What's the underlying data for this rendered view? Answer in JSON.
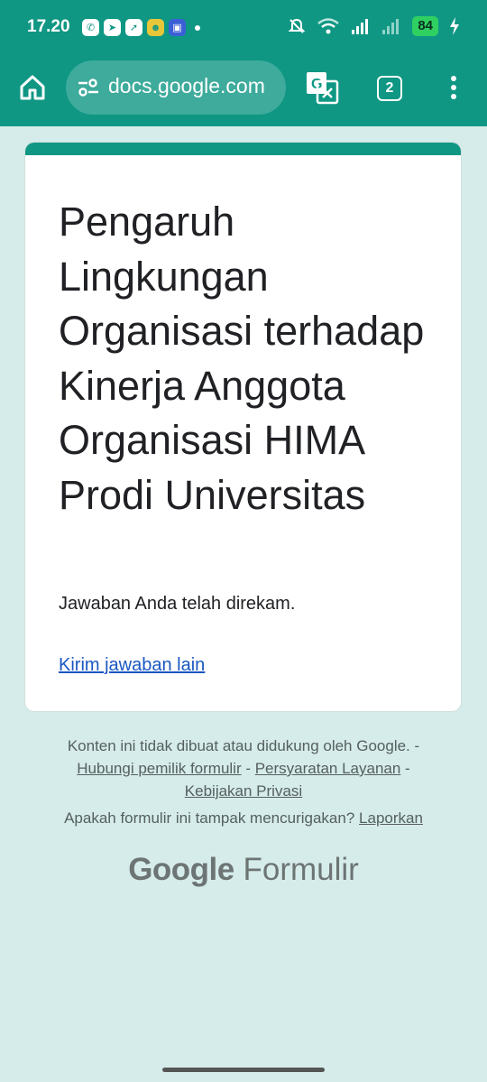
{
  "status_bar": {
    "time": "17.20",
    "battery": "84",
    "notification_icons": [
      "whatsapp-icon",
      "telegram-icon",
      "nav-arrow-icon",
      "app-icon",
      "app-icon"
    ],
    "system_icons": [
      "mute-icon",
      "wifi-icon",
      "signal-icon",
      "signal-icon",
      "battery-icon",
      "charging-icon"
    ]
  },
  "browser": {
    "url": "docs.google.com",
    "tab_count": "2"
  },
  "form": {
    "title": "Pengaruh Lingkungan Organisasi terhadap Kinerja Anggota Organisasi HIMA Prodi Universitas",
    "response_message": "Jawaban Anda telah direkam.",
    "submit_another_link": "Kirim jawaban lain"
  },
  "footer": {
    "disclaimer": "Konten ini tidak dibuat atau didukung oleh Google.",
    "sep1": " - ",
    "contact_owner": "Hubungi pemilik formulir",
    "sep2": " - ",
    "terms": "Persyaratan Layanan",
    "sep3": " - ",
    "privacy": "Kebijakan Privasi",
    "suspicious_question": "Apakah formulir ini tampak mencurigakan?",
    "report": "Laporkan",
    "brand_google": "Google",
    "brand_forms": "Formulir"
  },
  "colors": {
    "toolbar": "#0f9784",
    "background": "#d6ecea",
    "link": "#1a57c2"
  }
}
